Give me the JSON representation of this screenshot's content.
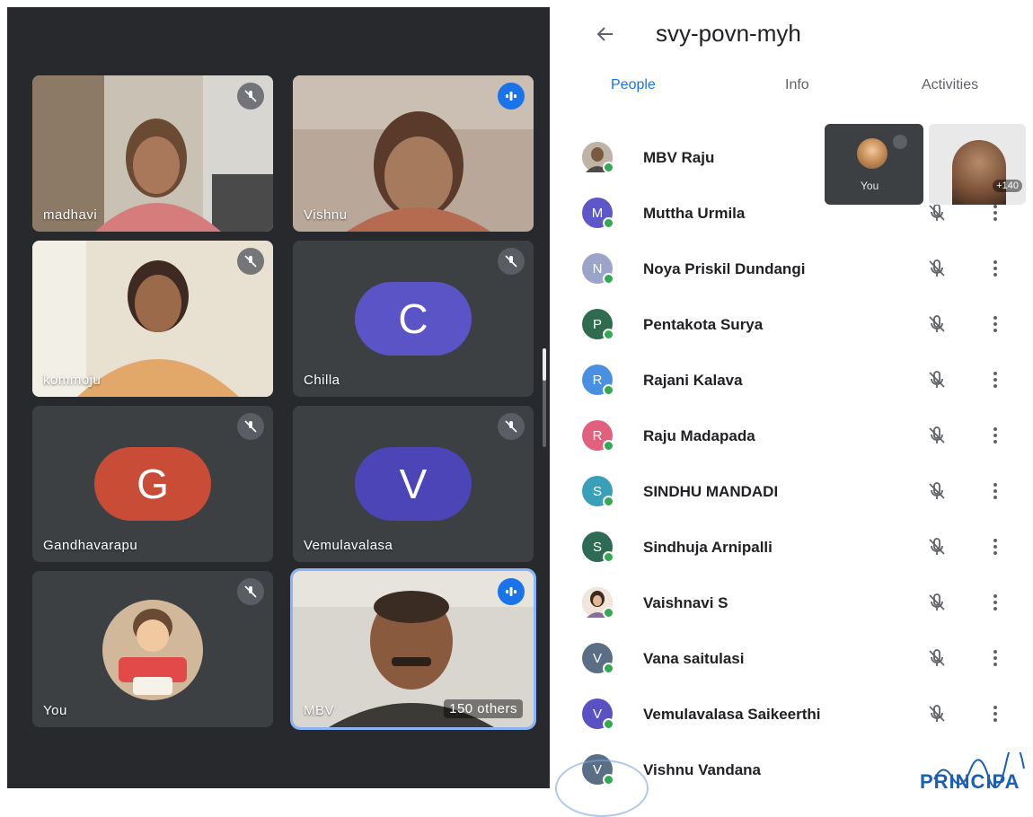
{
  "meeting": {
    "code": "svy-povn-myh",
    "tabs": [
      "People",
      "Info",
      "Activities"
    ],
    "active_tab": "People"
  },
  "tiles": [
    {
      "name": "madhavi",
      "kind": "video",
      "badge": "muted"
    },
    {
      "name": "Vishnu",
      "kind": "video",
      "badge": "speaking"
    },
    {
      "name": "kommoju",
      "kind": "video",
      "badge": "muted"
    },
    {
      "name": "Chilla",
      "kind": "letter",
      "letter": "C",
      "color": "#5b54c7",
      "badge": "muted"
    },
    {
      "name": "Gandhavarapu",
      "kind": "letter",
      "letter": "G",
      "color": "#c94c37",
      "badge": "muted"
    },
    {
      "name": "Vemulavalasa",
      "kind": "letter",
      "letter": "V",
      "color": "#4b45b8",
      "badge": "muted"
    },
    {
      "name": "You",
      "kind": "self",
      "badge": "muted"
    },
    {
      "name": "MBV",
      "kind": "video",
      "badge": "speaking",
      "others": "150 others"
    }
  ],
  "pip": {
    "self_label": "You",
    "other_count": "+140"
  },
  "participants": [
    {
      "name": "MBV Raju",
      "initial": "",
      "color": "#9e9e9e",
      "photo": true
    },
    {
      "name": "Muttha Urmila",
      "initial": "M",
      "color": "#5e57c9"
    },
    {
      "name": "Noya Priskil Dundangi",
      "initial": "N",
      "color": "#9aa5c9"
    },
    {
      "name": "Pentakota Surya",
      "initial": "P",
      "color": "#2f6b4f"
    },
    {
      "name": "Rajani Kalava",
      "initial": "R",
      "color": "#4a90e2"
    },
    {
      "name": "Raju Madapada",
      "initial": "R",
      "color": "#e0607e"
    },
    {
      "name": "SINDHU MANDADI",
      "initial": "S",
      "color": "#3a9fb8"
    },
    {
      "name": "Sindhuja Arnipalli",
      "initial": "S",
      "color": "#2e6b55"
    },
    {
      "name": "Vaishnavi S",
      "initial": "",
      "color": "#c6a48a",
      "photo": true
    },
    {
      "name": "Vana saitulasi",
      "initial": "V",
      "color": "#5a6e85"
    },
    {
      "name": "Vemulavalasa Saikeerthi",
      "initial": "V",
      "color": "#5a51c2"
    },
    {
      "name": "Vishnu Vandana",
      "initial": "V",
      "color": "#5a6e85"
    }
  ],
  "stamp_text": "PRINCIPA",
  "colors": {
    "accent": "#1a73e8",
    "grid_background": "#28292c",
    "tile_background": "#3c4043",
    "online_dot": "#34a853"
  },
  "icons": {
    "back": "arrow-left-icon",
    "mute": "mic-off-icon",
    "speaking": "audio-level-icon",
    "more": "more-vertical-icon"
  }
}
